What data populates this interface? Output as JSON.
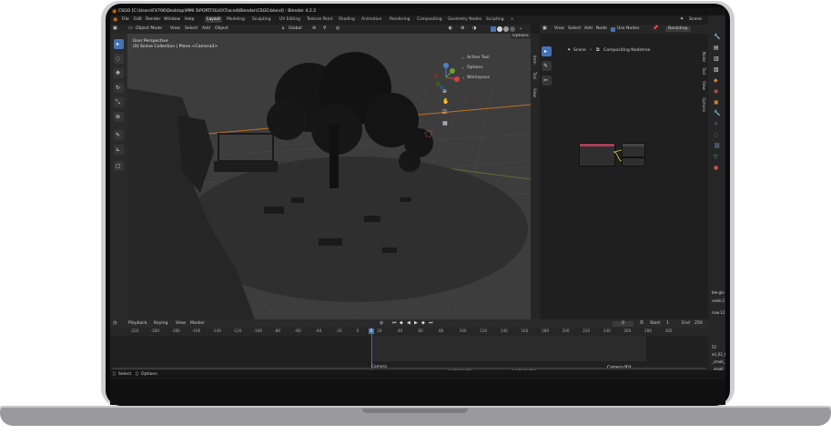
{
  "window": {
    "title": "CSGO [C:\\Users\\FX706\\Desktop\\MMI 3\\PORTFOLIO\\Traced\\Blender\\CSGO.blend] - Blender 4.2.2"
  },
  "menu": {
    "items": [
      "File",
      "Edit",
      "Render",
      "Window",
      "Help"
    ]
  },
  "workspaces": {
    "tabs": [
      "Layout",
      "Modeling",
      "Sculpting",
      "UV Editing",
      "Texture Paint",
      "Shading",
      "Animation",
      "Rendering",
      "Compositing",
      "Geometry Nodes",
      "Scripting"
    ],
    "active": "Layout",
    "add": "+"
  },
  "scene": {
    "label": "Scene"
  },
  "viewport_header": {
    "mode": "Object Mode",
    "menus": [
      "View",
      "Select",
      "Add",
      "Object"
    ],
    "orientation": "Global",
    "options": "Options"
  },
  "viewport": {
    "perspective": "User Perspective",
    "collection": "(0) Scene Collection | Plane.<Camera3>"
  },
  "tool_panel": {
    "items": [
      "Active Tool",
      "Options",
      "Workspace"
    ]
  },
  "npanel_tabs": [
    "Item",
    "Tool",
    "View"
  ],
  "node_editor": {
    "menus": [
      "View",
      "Select",
      "Add",
      "Node"
    ],
    "use_nodes": "Use Nodes",
    "backdrop": "Backdrop",
    "breadcrumb_scene": "Scene",
    "breadcrumb_tree": "Compositing Nodetree",
    "side_tabs": [
      "Node",
      "Tool",
      "View",
      "Options"
    ]
  },
  "timeline": {
    "menus": [
      "Playback",
      "Keying",
      "View",
      "Marker"
    ],
    "current_frame": "0",
    "start_label": "Start",
    "start_value": "1",
    "end_label": "End",
    "end_value": "250",
    "ticks": [
      "-220",
      "-200",
      "-180",
      "-160",
      "-140",
      "-120",
      "-100",
      "-80",
      "-60",
      "-40",
      "-20",
      "0",
      "20",
      "40",
      "60",
      "80",
      "100",
      "120",
      "140",
      "160",
      "180",
      "200",
      "220",
      "240",
      "260",
      "280",
      "300"
    ],
    "current_marker": "0",
    "markers": [
      "Camera",
      "Camera.001",
      "Camera.002",
      "Camera.003"
    ]
  },
  "outliner_fragments": [
    "ble-glo",
    "node:2",
    "now.12",
    "52",
    "all_02_t",
    "_small_",
    "_small_"
  ],
  "status_bar": {
    "items": [
      "Select",
      "Options"
    ]
  },
  "colors": {
    "accent_blue": "#4772b3",
    "active_tab": "#3c3c3c",
    "orange_axis": "#e38a1e",
    "playhead": "#4772b3"
  }
}
